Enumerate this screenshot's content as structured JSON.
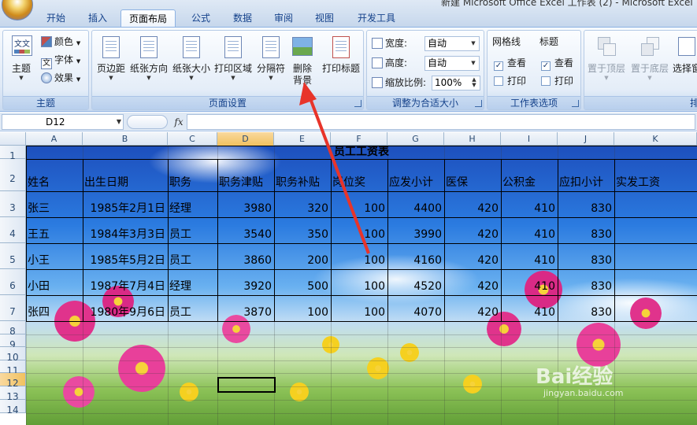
{
  "window": {
    "title": "新建 Microsoft Office Excel 工作表 (2) - Microsoft Excel"
  },
  "tabs": [
    {
      "label": "开始",
      "active": false
    },
    {
      "label": "插入",
      "active": false
    },
    {
      "label": "页面布局",
      "active": true
    },
    {
      "label": "公式",
      "active": false
    },
    {
      "label": "数据",
      "active": false
    },
    {
      "label": "审阅",
      "active": false
    },
    {
      "label": "视图",
      "active": false
    },
    {
      "label": "开发工具",
      "active": false
    }
  ],
  "ribbon": {
    "theme_group": {
      "label": "主题",
      "theme_button": "主题",
      "colors": "颜色",
      "fonts": "字体",
      "effects": "效果"
    },
    "page_setup_group": {
      "label": "页面设置",
      "margins": "页边距",
      "orientation": "纸张方向",
      "size": "纸张大小",
      "print_area": "打印区域",
      "breaks": "分隔符",
      "delete_background_1": "删除",
      "delete_background_2": "背景",
      "print_titles": "打印标题"
    },
    "scale_group": {
      "label": "调整为合适大小",
      "width_label": "宽度:",
      "width_value": "自动",
      "height_label": "高度:",
      "height_value": "自动",
      "scale_label": "缩放比例:",
      "scale_value": "100%"
    },
    "sheet_options_group": {
      "label": "工作表选项",
      "gridlines": "网格线",
      "headings": "标题",
      "view": "查看",
      "print": "打印",
      "gridlines_view_checked": true,
      "gridlines_print_checked": false,
      "headings_view_checked": true,
      "headings_print_checked": false
    },
    "arrange_group": {
      "bring_front": "置于顶层",
      "send_back": "置于底层",
      "selection_pane": "选择窗",
      "label_partial": "排"
    }
  },
  "formula_bar": {
    "name_box": "D12",
    "fx": "fx",
    "formula": ""
  },
  "sheet": {
    "columns": [
      "A",
      "B",
      "C",
      "D",
      "E",
      "F",
      "G",
      "H",
      "I",
      "J",
      "K"
    ],
    "rows": [
      "1",
      "2",
      "3",
      "4",
      "5",
      "6",
      "7",
      "8",
      "9",
      "10",
      "11",
      "12",
      "13",
      "14"
    ],
    "selected_cell": "D12",
    "title": "员工工资表",
    "headers": [
      "姓名",
      "出生日期",
      "职务",
      "职务津贴",
      "职务补贴",
      "岗位奖",
      "应发小计",
      "医保",
      "公积金",
      "应扣小计",
      "实发工资"
    ],
    "records": [
      [
        "张三",
        "1985年2月1日",
        "经理",
        "3980",
        "320",
        "100",
        "4400",
        "420",
        "410",
        "830",
        ""
      ],
      [
        "王五",
        "1984年3月3日",
        "员工",
        "3540",
        "350",
        "100",
        "3990",
        "420",
        "410",
        "830",
        ""
      ],
      [
        "小王",
        "1985年5月2日",
        "员工",
        "3860",
        "200",
        "100",
        "4160",
        "420",
        "410",
        "830",
        ""
      ],
      [
        "小田",
        "1987年7月4日",
        "经理",
        "3920",
        "500",
        "100",
        "4520",
        "420",
        "410",
        "830",
        ""
      ],
      [
        "张四",
        "1980年9月6日",
        "员工",
        "3870",
        "100",
        "100",
        "4070",
        "420",
        "410",
        "830",
        ""
      ]
    ]
  },
  "watermark": {
    "brand": "Bai经验",
    "url": "jingyan.baidu.com"
  },
  "annotation": {
    "color": "#e8342a"
  }
}
